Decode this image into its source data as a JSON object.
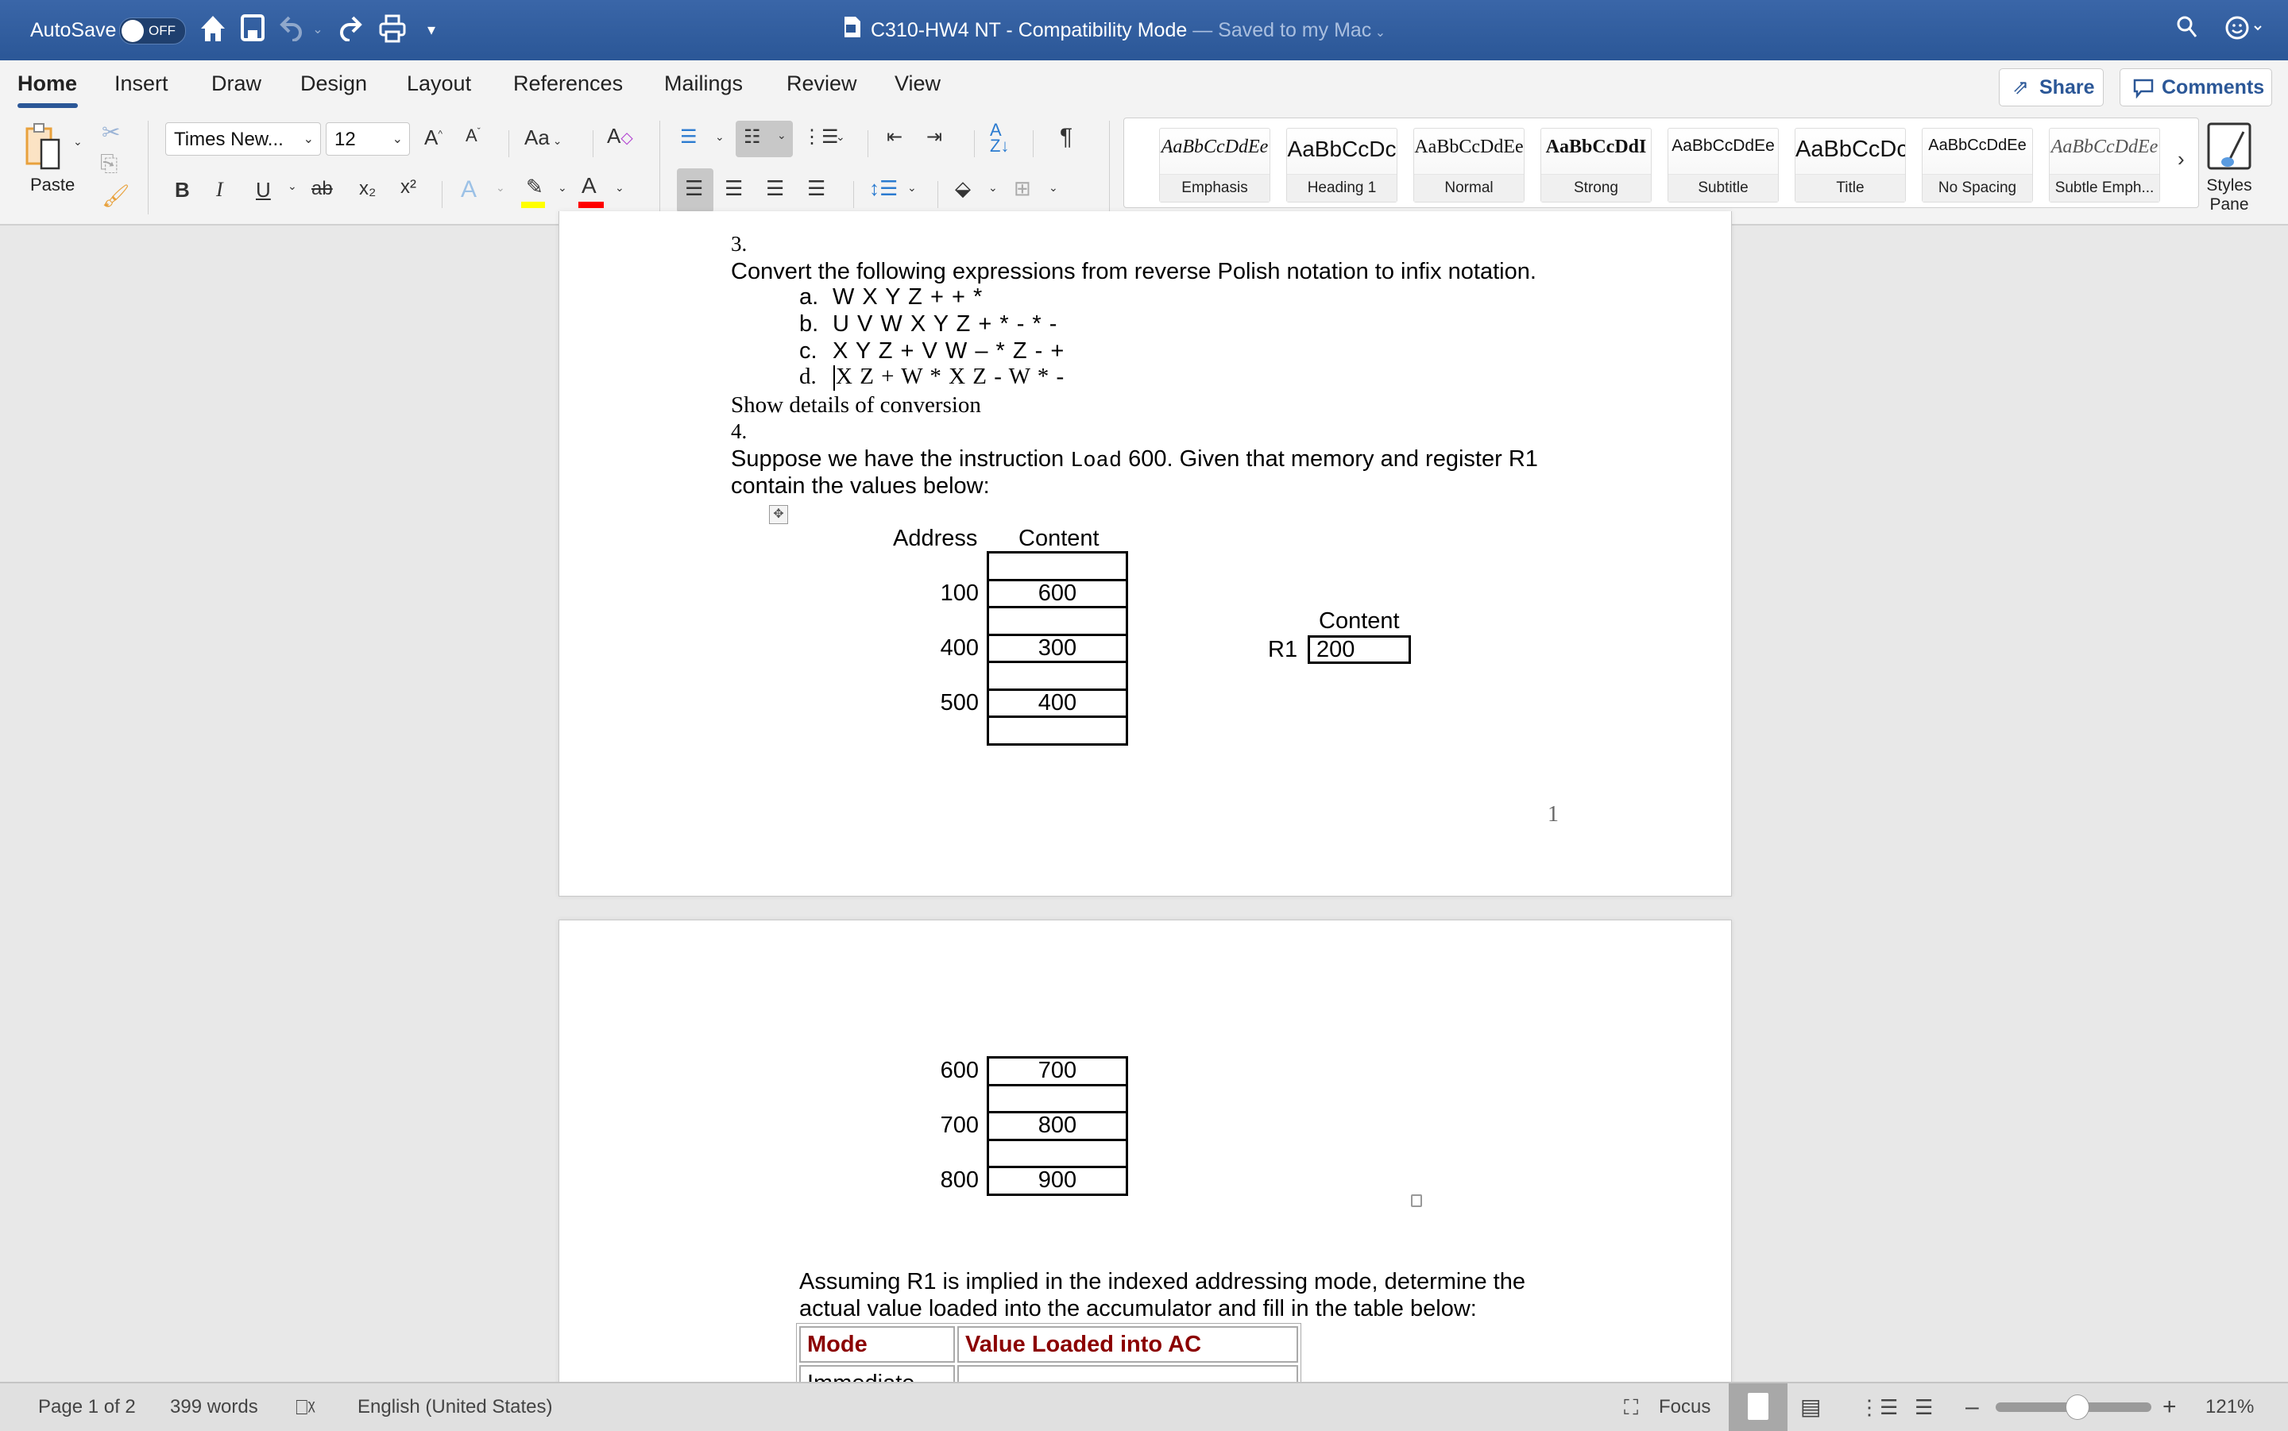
{
  "titlebar": {
    "autosave_label": "AutoSave",
    "autosave_state": "OFF",
    "doc_title": "C310-HW4 NT",
    "title_sep": " - ",
    "mode": "Compatibility Mode",
    "save_status": "— Saved to my Mac",
    "icons": [
      "home-icon",
      "save-icon",
      "undo-icon",
      "redo-icon",
      "print-icon",
      "customize-toolbar-icon",
      "search-icon",
      "feedback-smiley-icon"
    ]
  },
  "tabs": {
    "items": [
      "Home",
      "Insert",
      "Draw",
      "Design",
      "Layout",
      "References",
      "Mailings",
      "Review",
      "View"
    ],
    "active": "Home",
    "share_label": "Share",
    "comments_label": "Comments"
  },
  "ribbon": {
    "paste_label": "Paste",
    "font_name": "Times New...",
    "font_size": "12",
    "change_case": "Aa",
    "bold": "B",
    "italic": "I",
    "underline": "U",
    "strike": "ab",
    "subscript": "x₂",
    "superscript": "x²",
    "pilcrow": "¶",
    "highlight_color": "#ffff00",
    "font_color": "#ff0000",
    "styles": [
      {
        "preview": "AaBbCcDdEe",
        "name": "Emphasis"
      },
      {
        "preview": "AaBbCcDc",
        "name": "Heading 1"
      },
      {
        "preview": "AaBbCcDdEe",
        "name": "Normal"
      },
      {
        "preview": "AaBbCcDdI",
        "name": "Strong"
      },
      {
        "preview": "AaBbCcDdEe",
        "name": "Subtitle"
      },
      {
        "preview": "AaBbCcDc",
        "name": "Title"
      },
      {
        "preview": "AaBbCcDdEe",
        "name": "No Spacing"
      },
      {
        "preview": "AaBbCcDdEe",
        "name": "Subtle Emph..."
      }
    ],
    "styles_pane_line1": "Styles",
    "styles_pane_line2": "Pane"
  },
  "document": {
    "q3": {
      "number": "3.",
      "prompt": "Convert the following expressions from reverse Polish notation to infix notation.",
      "items": [
        {
          "label": "a.",
          "expr": "W X Y Z + + *"
        },
        {
          "label": "b.",
          "expr": "U V W X Y Z + * - * -"
        },
        {
          "label": "c.",
          "expr": "X Y Z + V W – * Z - +"
        },
        {
          "label": "d.",
          "expr": "X Z + W * X Z - W * -"
        }
      ],
      "note": "Show details of conversion"
    },
    "q4": {
      "number": "4.",
      "line1_pre": "Suppose we have the instruction ",
      "line1_code": "Load",
      "line1_post": " 600. Given that memory and register R1",
      "line2": "contain the values below:",
      "address_header": "Address",
      "content_header": "Content",
      "memory_page1": [
        {
          "address": "",
          "content": ""
        },
        {
          "address": "100",
          "content": "600"
        },
        {
          "address": "",
          "content": ""
        },
        {
          "address": "400",
          "content": "300"
        },
        {
          "address": "",
          "content": ""
        },
        {
          "address": "500",
          "content": "400"
        },
        {
          "address": "",
          "content": ""
        }
      ],
      "register": {
        "header": "Content",
        "name": "R1",
        "value": "200"
      },
      "memory_page2": [
        {
          "address": "600",
          "content": "700"
        },
        {
          "address": "",
          "content": ""
        },
        {
          "address": "700",
          "content": "800"
        },
        {
          "address": "",
          "content": ""
        },
        {
          "address": "800",
          "content": "900"
        }
      ],
      "instruction_line1": "Assuming R1 is implied in the indexed addressing mode, determine the",
      "instruction_line2": "actual value loaded into the accumulator and fill in the table below:",
      "table_headers": [
        "Mode",
        "Value Loaded into AC"
      ],
      "table_rows": [
        [
          "Immediate",
          ""
        ]
      ]
    },
    "page_number": "1"
  },
  "status": {
    "page": "Page 1 of 2",
    "words": "399 words",
    "language": "English (United States)",
    "focus": "Focus",
    "zoom": "121%",
    "zoom_fraction": 0.52
  }
}
